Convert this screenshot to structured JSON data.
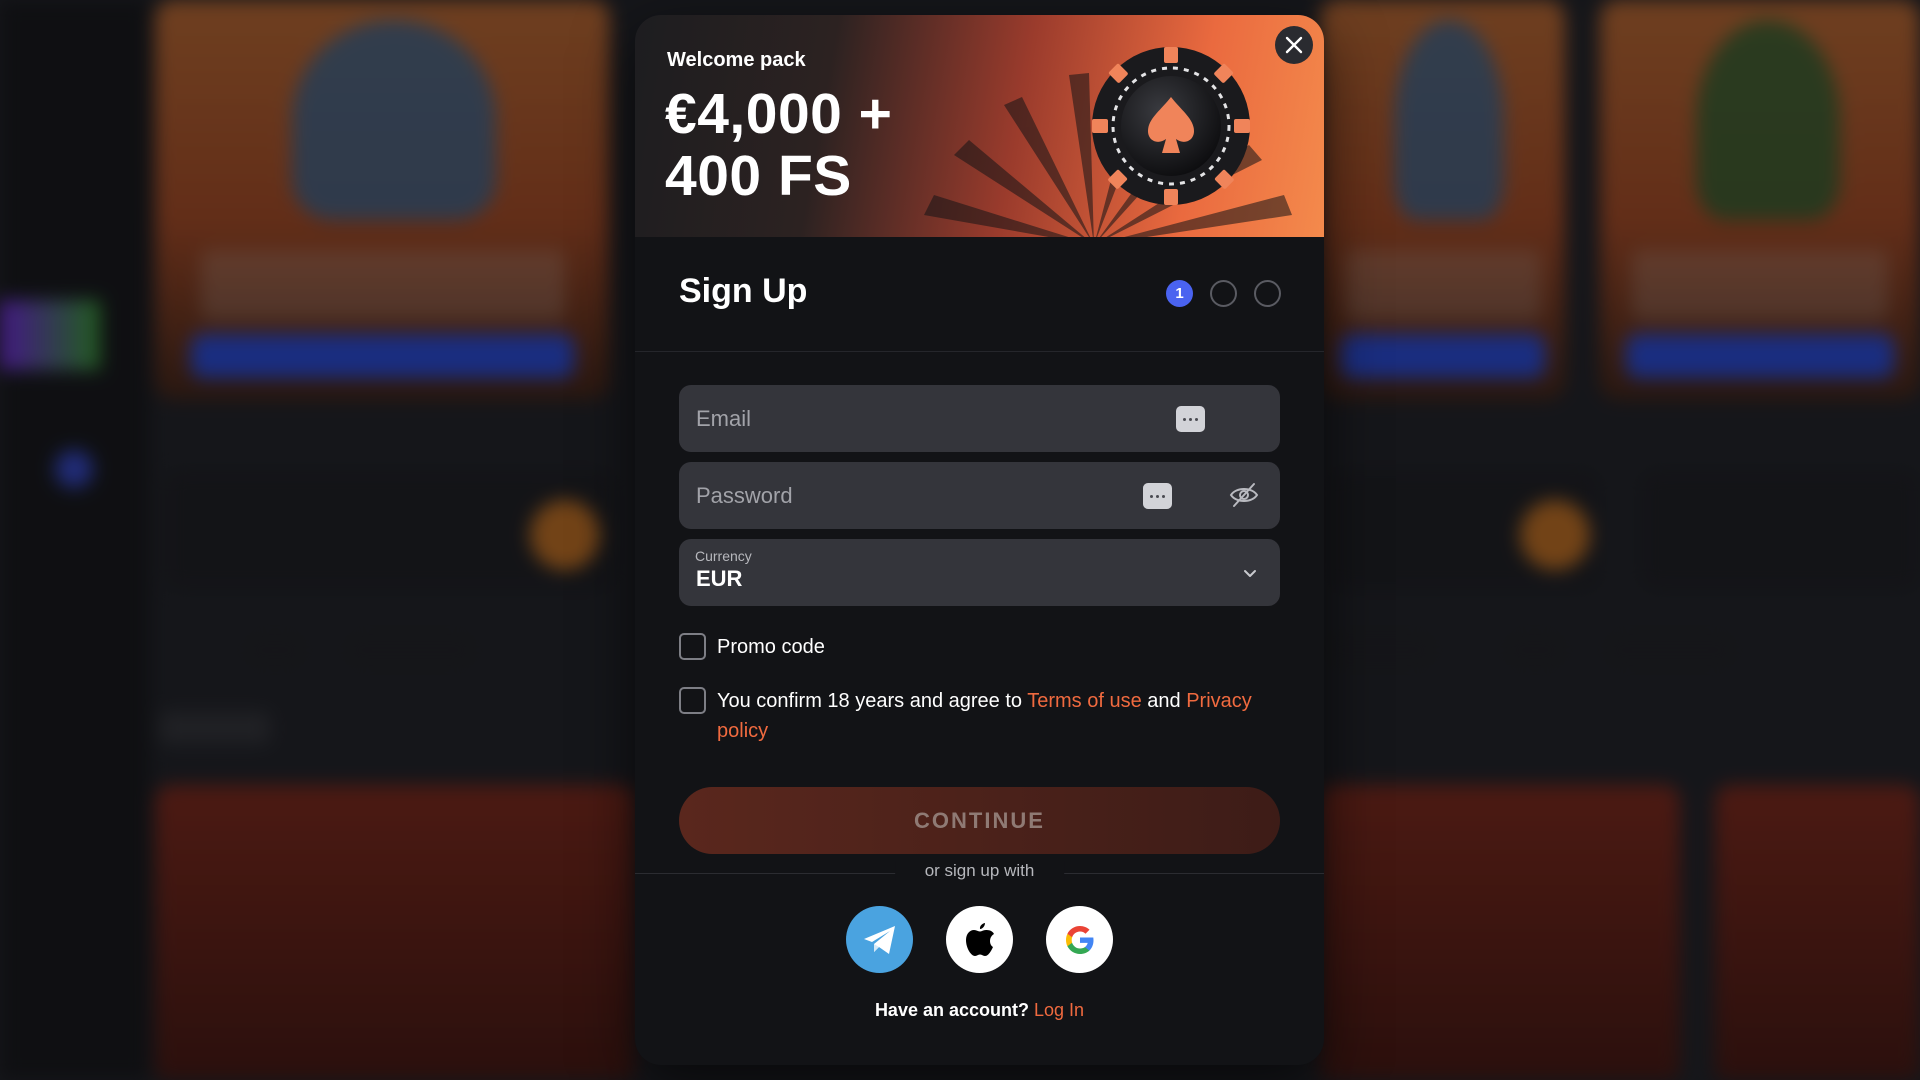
{
  "hero": {
    "kicker": "Welcome pack",
    "title_line1": "€4,000 +",
    "title_line2": "400 FS"
  },
  "close_icon": "close-icon",
  "signup": {
    "title": "Sign Up",
    "steps": [
      "1",
      "",
      ""
    ],
    "active_step": 1
  },
  "form": {
    "email_placeholder": "Email",
    "password_placeholder": "Password",
    "currency_label": "Currency",
    "currency_value": "EUR",
    "promo_label": "Promo code",
    "terms_prefix": "You confirm 18 years and agree to ",
    "terms_link": "Terms of use",
    "terms_mid": " and ",
    "privacy_link": "Privacy policy",
    "continue_label": "CONTINUE"
  },
  "social": {
    "divider_text": "or sign up with",
    "providers": [
      "telegram-icon",
      "apple-icon",
      "google-icon"
    ]
  },
  "footer": {
    "have_account": "Have an account?",
    "login_link": "Log In"
  },
  "colors": {
    "accent": "#f06a3f",
    "step_active": "#4a63f0",
    "telegram": "#4aa3e0"
  }
}
